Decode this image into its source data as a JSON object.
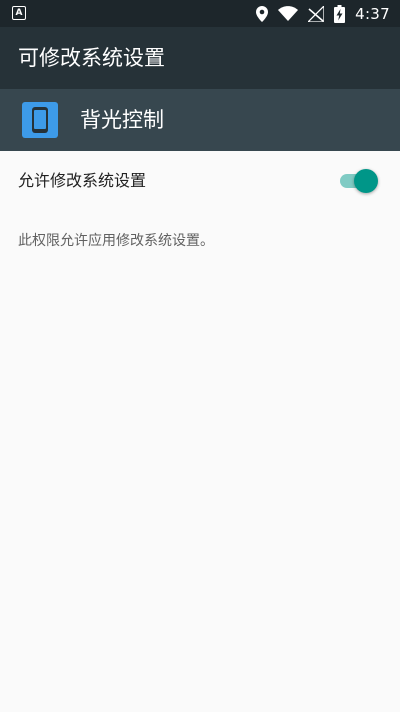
{
  "status_bar": {
    "left_icon": "a-icon",
    "left_glyph": "A",
    "icons": [
      "location-icon",
      "wifi-icon",
      "no-signal-icon",
      "battery-charging-icon"
    ],
    "time": "4:37"
  },
  "toolbar": {
    "title": "可修改系统设置"
  },
  "app": {
    "icon": "phone-icon",
    "name": "背光控制",
    "icon_color": "#3d9be9"
  },
  "setting": {
    "label": "允许修改系统设置",
    "toggle_on": true,
    "toggle_color": "#009688",
    "description": "此权限允许应用修改系统设置。"
  },
  "colors": {
    "status_bar": "#1d262b",
    "toolbar": "#263238",
    "app_header": "#37474f",
    "background": "#fafafa"
  }
}
